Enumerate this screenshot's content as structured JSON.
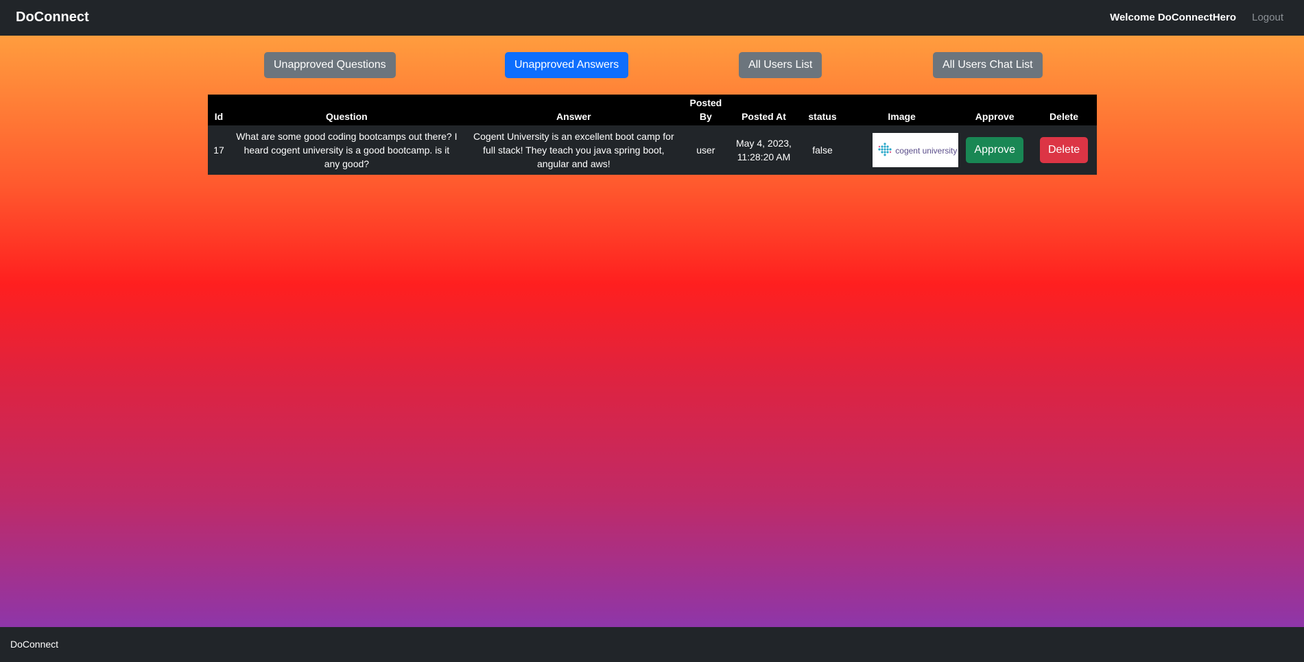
{
  "nav": {
    "brand": "DoConnect",
    "welcome": "Welcome DoConnectHero",
    "logout": "Logout"
  },
  "tabs": [
    {
      "label": "Unapproved Questions",
      "active": false
    },
    {
      "label": "Unapproved Answers",
      "active": true
    },
    {
      "label": "All Users List",
      "active": false
    },
    {
      "label": "All Users Chat List",
      "active": false
    }
  ],
  "table": {
    "headers": [
      "Id",
      "Question",
      "Answer",
      "Posted By",
      "Posted At",
      "status",
      "Image",
      "Approve",
      "Delete"
    ],
    "rows": [
      {
        "id": "17",
        "question": "What are some good coding bootcamps out there? I heard cogent university is a good bootcamp. is it any good?",
        "answer": "Cogent University is an excellent boot camp for full stack! They teach you java spring boot, angular and aws!",
        "posted_by": "user",
        "posted_at": "May 4, 2023, 11:28:20 AM",
        "status": "false",
        "image_text": "cogent university",
        "approve_label": "Approve",
        "delete_label": "Delete"
      }
    ]
  },
  "footer": {
    "text": "DoConnect"
  },
  "colors": {
    "navbar": "#212529",
    "primary": "#0d6efd",
    "secondary": "#6c757d",
    "success": "#198754",
    "danger": "#dc3545"
  }
}
